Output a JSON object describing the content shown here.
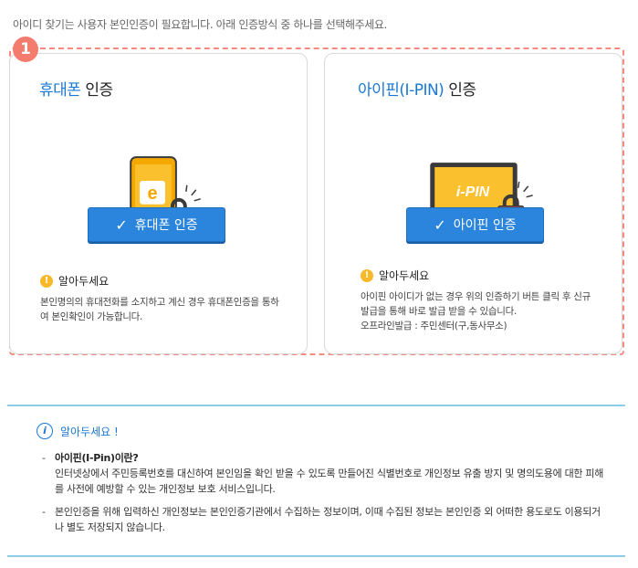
{
  "intro": "아이디 찾기는 사용자 본인인증이 필요합니다. 아래 인증방식 중 하나를 선택해주세요.",
  "step_number": "1",
  "accent_color": "#2b85dc",
  "dashed_color": "#f58b80",
  "phone_card": {
    "title_highlight": "휴대폰",
    "title_rest": " 인증",
    "icon_letter": "e",
    "button_label": "휴대폰 인증",
    "notice_title": "알아두세요",
    "notice_text": "본인명의의 휴대전화를 소지하고 계신 경우 휴대폰인증을 통하여 본인확인이 가능합니다."
  },
  "ipin_card": {
    "title_highlight": "아이핀(I-PIN)",
    "title_rest": " 인증",
    "screen_text": "i-PIN",
    "button_label": "아이핀 인증",
    "notice_title": "알아두세요",
    "notice_line1": "아이핀 아이디가 없는 경우 위의 인증하기 버튼 클릭 후 신규발급을 통해 바로 발급 받을 수 있습니다.",
    "notice_line2": "오프라인발급 : 주민센터(구,동사무소)"
  },
  "info": {
    "title": "알아두세요 !",
    "items": [
      {
        "term": "아이핀(I-Pin)이란?",
        "desc": "인터넷상에서 주민등록번호를 대신하여 본인임을 확인 받을 수 있도록 만들어진 식별번호로 개인정보 유출 방지 및 명의도용에 대한 피해를 사전에 예방할 수 있는 개인정보 보호 서비스입니다."
      },
      {
        "term": "",
        "desc": "본인인증을 위해 입력하신 개인정보는 본인인증기관에서 수집하는 정보이며, 이때 수집된 정보는 본인인증 외 어떠한 용도로도 이용되거나 별도 저장되지 않습니다."
      }
    ]
  }
}
